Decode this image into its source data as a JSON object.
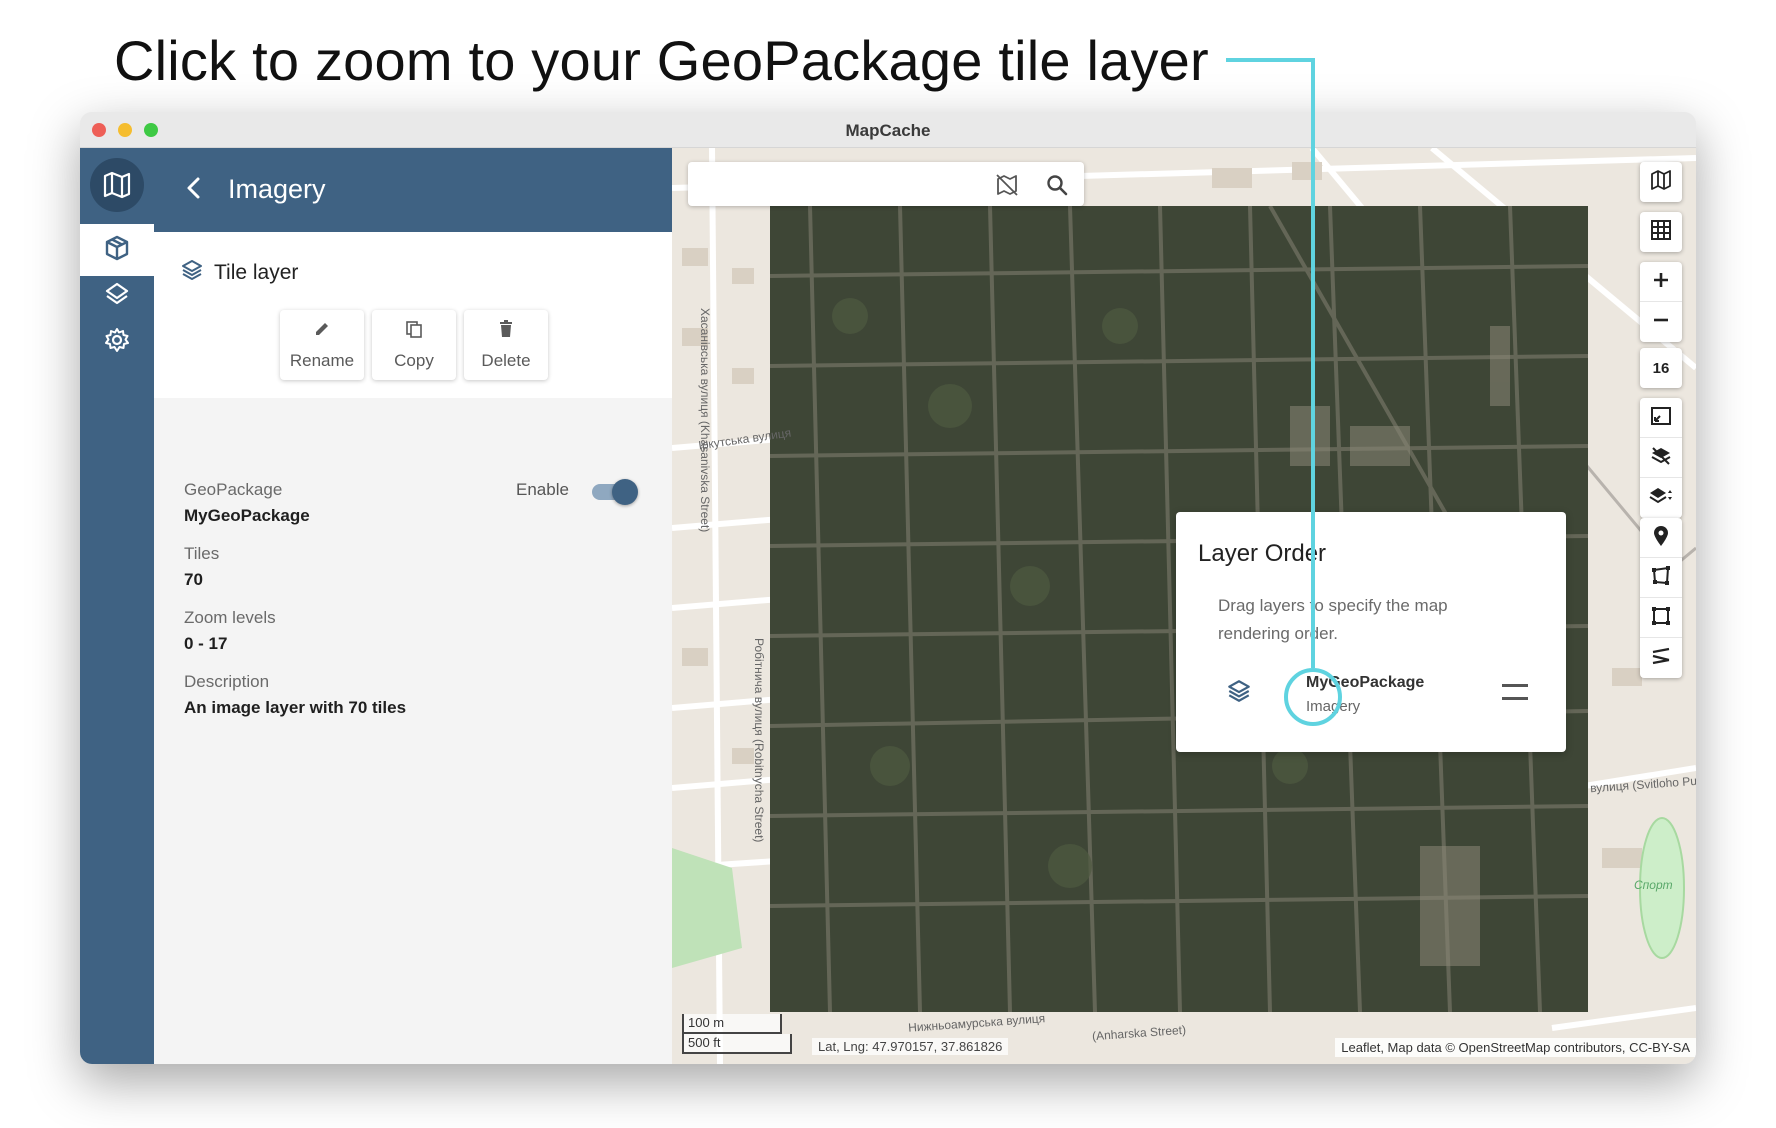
{
  "callout": {
    "text": "Click to zoom to your GeoPackage tile layer"
  },
  "window": {
    "title": "MapCache"
  },
  "sidebar": {
    "items": [
      {
        "name": "geopackage",
        "icon": "package-icon",
        "active": true
      },
      {
        "name": "layers",
        "icon": "layers-icon",
        "active": false
      },
      {
        "name": "settings",
        "icon": "gear-icon",
        "active": false
      }
    ]
  },
  "panel": {
    "title": "Imagery",
    "layer_type": "Tile layer",
    "actions": {
      "rename": "Rename",
      "copy": "Copy",
      "delete": "Delete"
    },
    "fields": {
      "geopackage_label": "GeoPackage",
      "geopackage_value": "MyGeoPackage",
      "enable_label": "Enable",
      "enabled": true,
      "tiles_label": "Tiles",
      "tiles_value": "70",
      "zoom_label": "Zoom levels",
      "zoom_value": "0 - 17",
      "description_label": "Description",
      "description_value": "An image layer with 70 tiles"
    }
  },
  "map": {
    "search_placeholder": "",
    "zoom_level": "16",
    "layer_order": {
      "title": "Layer Order",
      "description": "Drag layers to specify the map rendering order.",
      "item_name": "MyGeoPackage",
      "item_sub": "Imagery"
    },
    "scale_metric": "100 m",
    "scale_imperial": "500 ft",
    "coords": "Lat, Lng: 47.970157, 37.861826",
    "attribution": "Leaflet, Map data © OpenStreetMap contributors, CC-BY-SA",
    "street_labels": [
      "Хасанівська вулиця (Khasanivska Street)",
      "Іркутська вулиця",
      "Робітнича вулиця (Robitnycha Street)",
      "вулиця (Svitloho Puti Street)",
      "Нижньоамурська вулиця",
      "(Anharska Street)",
      "Спорт"
    ]
  },
  "colors": {
    "brand": "#3f6283",
    "callout": "#5fd3e0",
    "satellite": "#3e4636"
  }
}
